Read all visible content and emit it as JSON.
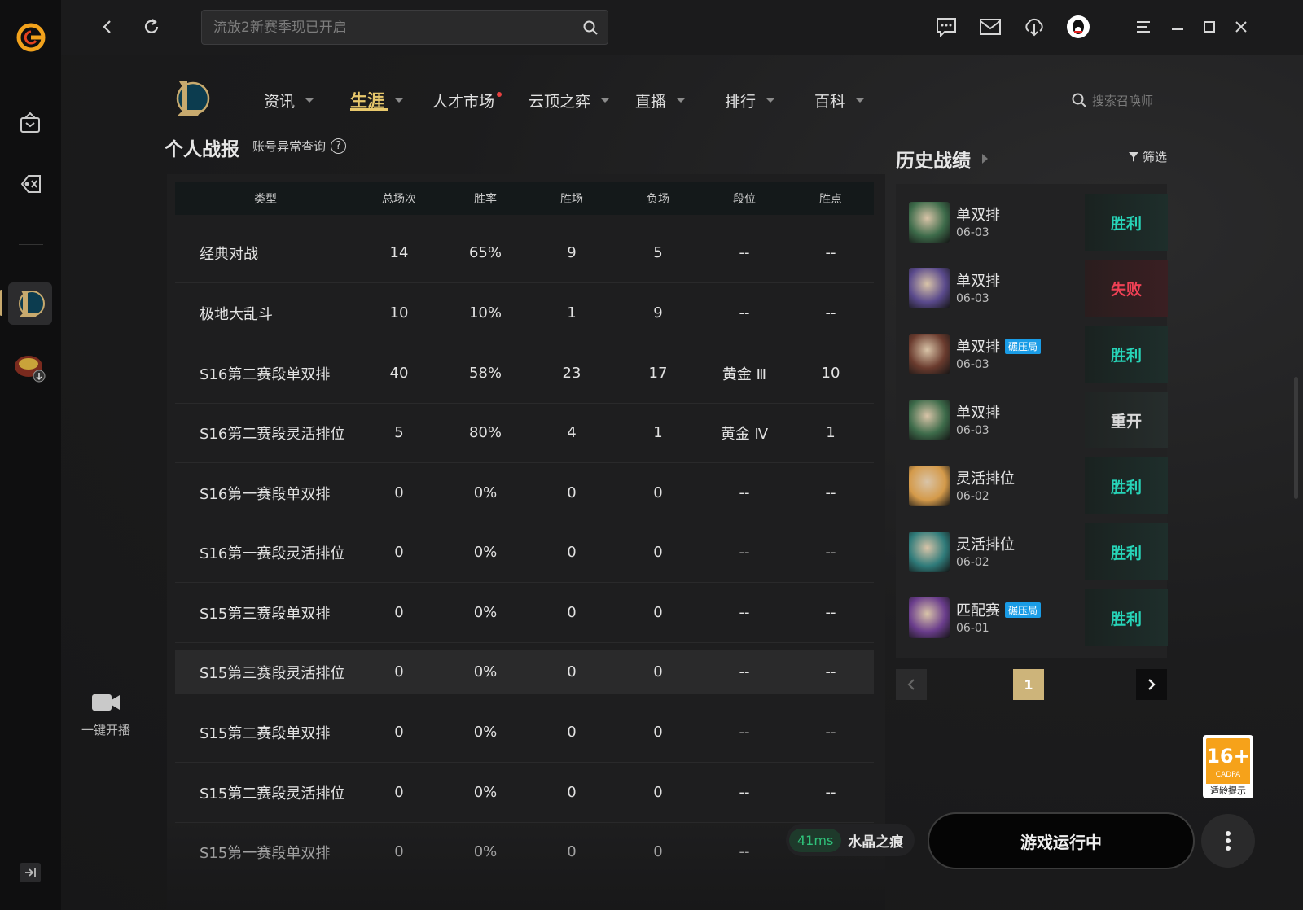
{
  "app": {
    "search_placeholder": "流放2新赛季现已开启",
    "live_label": "一键开播"
  },
  "nav": {
    "items": [
      {
        "label": "资讯",
        "caret": true
      },
      {
        "label": "生涯",
        "caret": true,
        "active": true
      },
      {
        "label": "人才市场",
        "dot": true
      },
      {
        "label": "云顶之弈",
        "caret": true
      },
      {
        "label": "直播",
        "caret": true
      },
      {
        "label": "排行",
        "caret": true
      },
      {
        "label": "百科",
        "caret": true
      }
    ],
    "summoner_search_placeholder": "搜索召唤师"
  },
  "stats": {
    "title": "个人战报",
    "account_check": "账号异常查询",
    "help": "?",
    "headers": [
      "类型",
      "总场次",
      "胜率",
      "胜场",
      "负场",
      "段位",
      "胜点"
    ],
    "rows": [
      [
        "经典对战",
        "14",
        "65%",
        "9",
        "5",
        "--",
        "--"
      ],
      [
        "极地大乱斗",
        "10",
        "10%",
        "1",
        "9",
        "--",
        "--"
      ],
      [
        "S16第二赛段单双排",
        "40",
        "58%",
        "23",
        "17",
        "黄金 Ⅲ",
        "10"
      ],
      [
        "S16第二赛段灵活排位",
        "5",
        "80%",
        "4",
        "1",
        "黄金 Ⅳ",
        "1"
      ],
      [
        "S16第一赛段单双排",
        "0",
        "0%",
        "0",
        "0",
        "--",
        "--"
      ],
      [
        "S16第一赛段灵活排位",
        "0",
        "0%",
        "0",
        "0",
        "--",
        "--"
      ],
      [
        "S15第三赛段单双排",
        "0",
        "0%",
        "0",
        "0",
        "--",
        "--"
      ],
      [
        "S15第三赛段灵活排位",
        "0",
        "0%",
        "0",
        "0",
        "--",
        "--"
      ],
      [
        "S15第二赛段单双排",
        "0",
        "0%",
        "0",
        "0",
        "--",
        "--"
      ],
      [
        "S15第二赛段灵活排位",
        "0",
        "0%",
        "0",
        "0",
        "--",
        "--"
      ],
      [
        "S15第一赛段单双排",
        "0",
        "0%",
        "0",
        "0",
        "--",
        "--"
      ]
    ]
  },
  "history": {
    "title": "历史战绩",
    "filter": "筛选",
    "matches": [
      {
        "mode": "单双排",
        "date": "06-03",
        "badge": "",
        "result": "胜利",
        "kind": "win",
        "color": "#3d6b4a"
      },
      {
        "mode": "单双排",
        "date": "06-03",
        "badge": "",
        "result": "失败",
        "kind": "lose",
        "color": "#5a4a8c"
      },
      {
        "mode": "单双排",
        "date": "06-03",
        "badge": "碾压局",
        "result": "胜利",
        "kind": "win",
        "color": "#6a3b2e"
      },
      {
        "mode": "单双排",
        "date": "06-03",
        "badge": "",
        "result": "重开",
        "kind": "re",
        "color": "#3d6b4a"
      },
      {
        "mode": "灵活排位",
        "date": "06-02",
        "badge": "",
        "result": "胜利",
        "kind": "win",
        "color": "#d49a4a"
      },
      {
        "mode": "灵活排位",
        "date": "06-02",
        "badge": "",
        "result": "胜利",
        "kind": "win",
        "color": "#2f7b7a"
      },
      {
        "mode": "匹配赛",
        "date": "06-01",
        "badge": "碾压局",
        "result": "胜利",
        "kind": "win",
        "color": "#6a3d8c"
      }
    ],
    "page": "1"
  },
  "footer": {
    "ping": "41ms",
    "server": "水晶之痕",
    "run_label": "游戏运行中",
    "age_num": "16+",
    "age_sub": "CADPA",
    "age_tip": "适龄提示"
  },
  "colors": {
    "accent_gold": "#e8c86c",
    "win": "#27d4b8",
    "lose": "#ef4155",
    "badge_blue": "#1a9ce6"
  }
}
